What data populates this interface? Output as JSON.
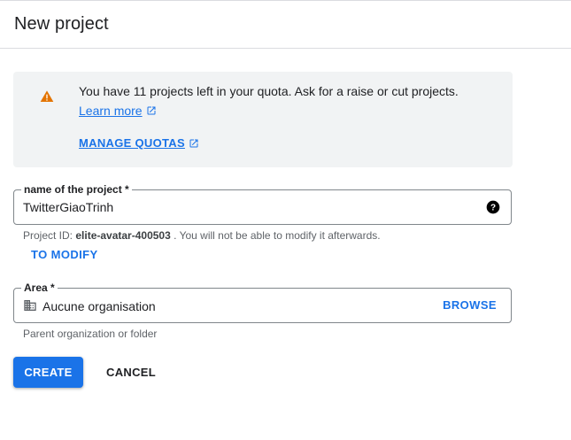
{
  "header": {
    "title": "New project"
  },
  "quota": {
    "message": "You have 11 projects left in your quota. Ask for a raise or cut projects.",
    "learn_more": "Learn more",
    "manage_quotas": "MANAGE QUOTAS",
    "warning_color": "#e37400",
    "icons": {
      "warning": "warning-triangle-icon",
      "external": "open-in-new-icon"
    }
  },
  "project_name": {
    "label": "name of the project *",
    "value": "TwitterGiaoTrinh",
    "help_icon": "help-circle-icon"
  },
  "project_id": {
    "prefix": "Project ID:",
    "id": "elite-avatar-400503",
    "suffix": ". You will not be able to modify it afterwards.",
    "modify_label": "TO MODIFY"
  },
  "area": {
    "label": "Area *",
    "value": "Aucune organisation",
    "browse_label": "BROWSE",
    "hint": "Parent organization or folder",
    "icon": "organization-building-icon"
  },
  "actions": {
    "create_label": "CREATE",
    "cancel_label": "CANCEL",
    "primary_color": "#1a73e8"
  }
}
